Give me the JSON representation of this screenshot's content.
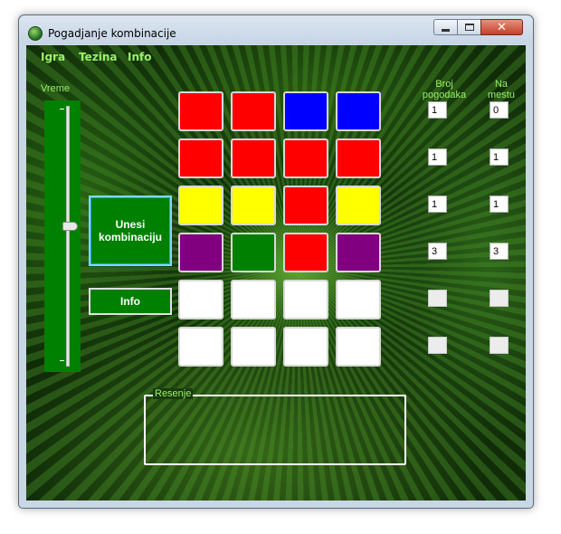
{
  "window": {
    "title": "Pogadjanje kombinacije",
    "minimize_glyph": "minimize-icon",
    "maximize_glyph": "maximize-icon",
    "close_glyph": "✕"
  },
  "menu": [
    {
      "label": "Igra"
    },
    {
      "label": "Tezina"
    },
    {
      "label": "Info"
    }
  ],
  "timer": {
    "label": "Vreme",
    "top_tick": "-",
    "bottom_tick": "-"
  },
  "buttons": {
    "enter_line1": "Unesi",
    "enter_line2": "kombinaciju",
    "info": "Info"
  },
  "score_headers": {
    "hits_line1": "Broj",
    "hits_line2": "pogodaka",
    "place_line1": "Na",
    "place_line2": "mestu"
  },
  "colors": {
    "red": "#ff0000",
    "blue": "#0000ff",
    "yellow": "#ffff00",
    "purple": "#800080",
    "green": "#008000",
    "empty": "#ffffff"
  },
  "board": [
    [
      "red",
      "red",
      "blue",
      "blue"
    ],
    [
      "red",
      "red",
      "red",
      "red"
    ],
    [
      "yellow",
      "yellow",
      "red",
      "yellow"
    ],
    [
      "purple",
      "green",
      "red",
      "purple"
    ],
    [
      "empty",
      "empty",
      "empty",
      "empty"
    ],
    [
      "empty",
      "empty",
      "empty",
      "empty"
    ]
  ],
  "scores": [
    {
      "hits": "1",
      "in_place": "0"
    },
    {
      "hits": "1",
      "in_place": "1"
    },
    {
      "hits": "1",
      "in_place": "1"
    },
    {
      "hits": "3",
      "in_place": "3"
    },
    {
      "hits": "",
      "in_place": ""
    },
    {
      "hits": "",
      "in_place": ""
    }
  ],
  "solution": {
    "label": "Resenje"
  }
}
